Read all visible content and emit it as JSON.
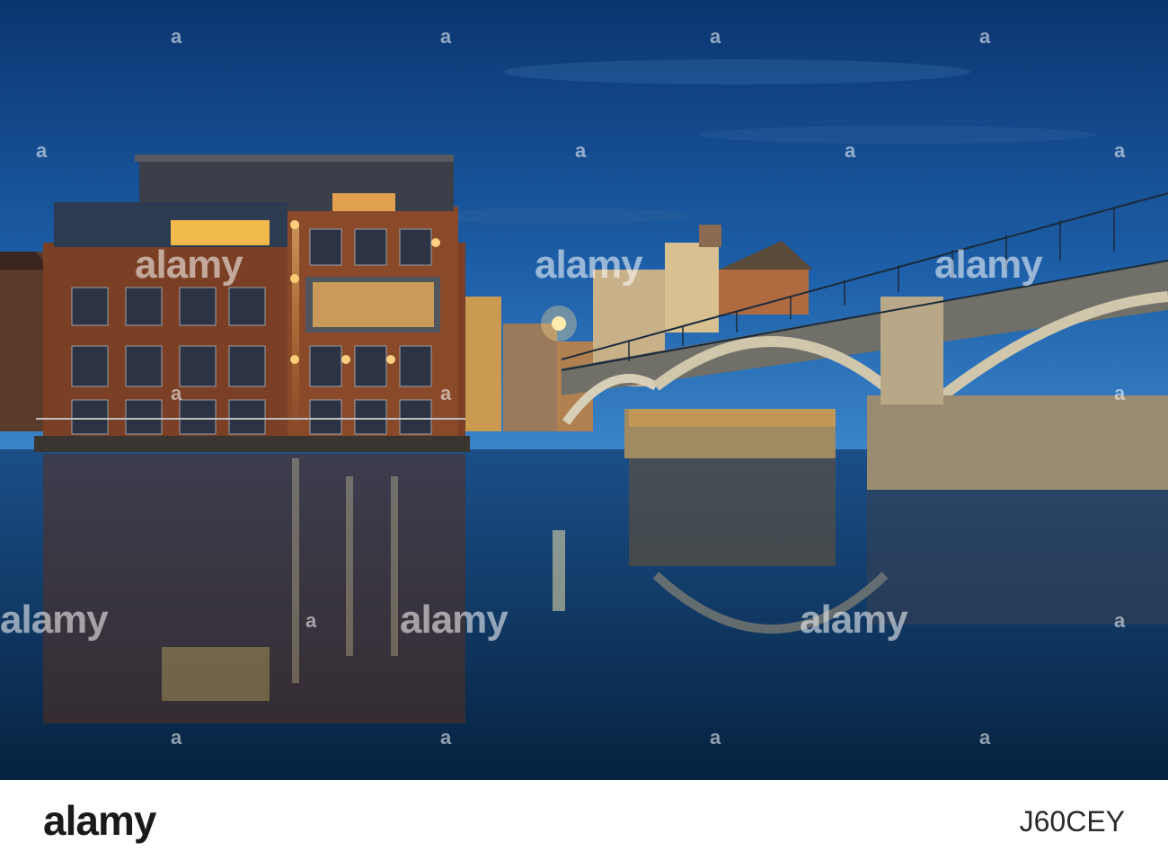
{
  "watermark": {
    "text": "alamy",
    "small_text": "a"
  },
  "footer": {
    "logo": "alamy",
    "image_code": "J60CEY"
  },
  "colors": {
    "sky_top": "#0d3a78",
    "sky_bottom": "#2d74c2",
    "water": "#0a3a6a",
    "brick": "#8a4a2a",
    "window_light": "#f5c060",
    "bridge_stone": "#b0a080"
  }
}
